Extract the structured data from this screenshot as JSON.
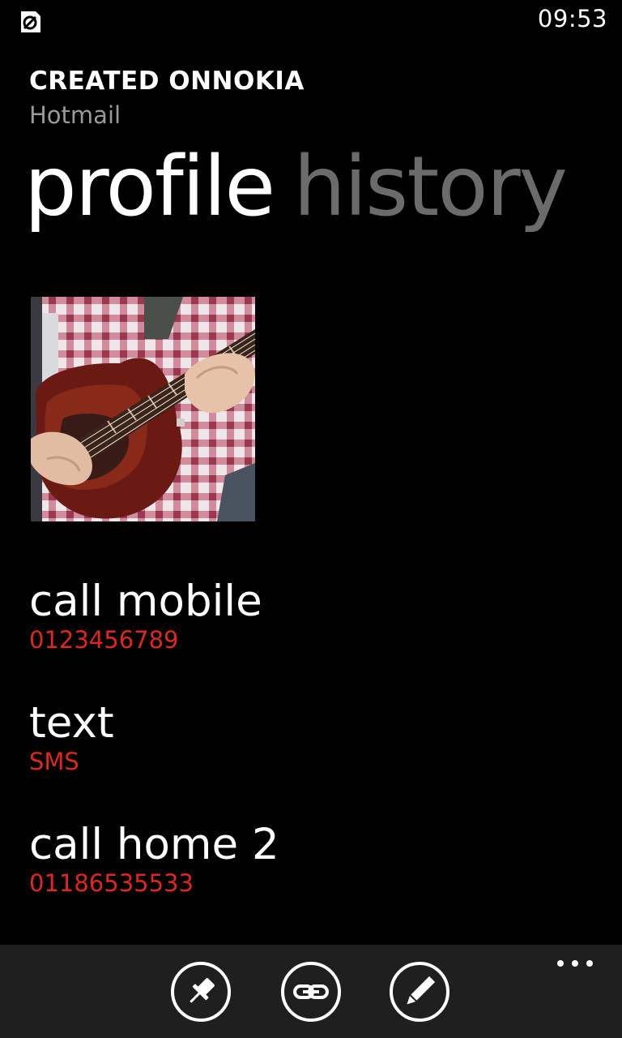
{
  "status_bar": {
    "time": "09:53",
    "icon": "app-status-icon"
  },
  "contact": {
    "name": "CREATED ONNOKIA",
    "source": "Hotmail"
  },
  "pivot": {
    "tabs": [
      {
        "label": "profile",
        "active": true
      },
      {
        "label": "history",
        "active": false
      }
    ]
  },
  "photo": {
    "description_icon": "contact-photo"
  },
  "actions": [
    {
      "label": "call mobile",
      "detail": "0123456789"
    },
    {
      "label": "text",
      "detail": "SMS"
    },
    {
      "label": "call home 2",
      "detail": "01186535533"
    }
  ],
  "app_bar": {
    "buttons": [
      {
        "icon": "pin-icon"
      },
      {
        "icon": "link-icon"
      },
      {
        "icon": "edit-icon"
      }
    ],
    "more_icon": "more-dots-icon"
  },
  "colors": {
    "accent": "#e2261a",
    "background": "#000000",
    "app_bar": "#1f1f1f",
    "inactive_text": "#6b6b6b",
    "secondary_text": "#9a9a9a"
  }
}
